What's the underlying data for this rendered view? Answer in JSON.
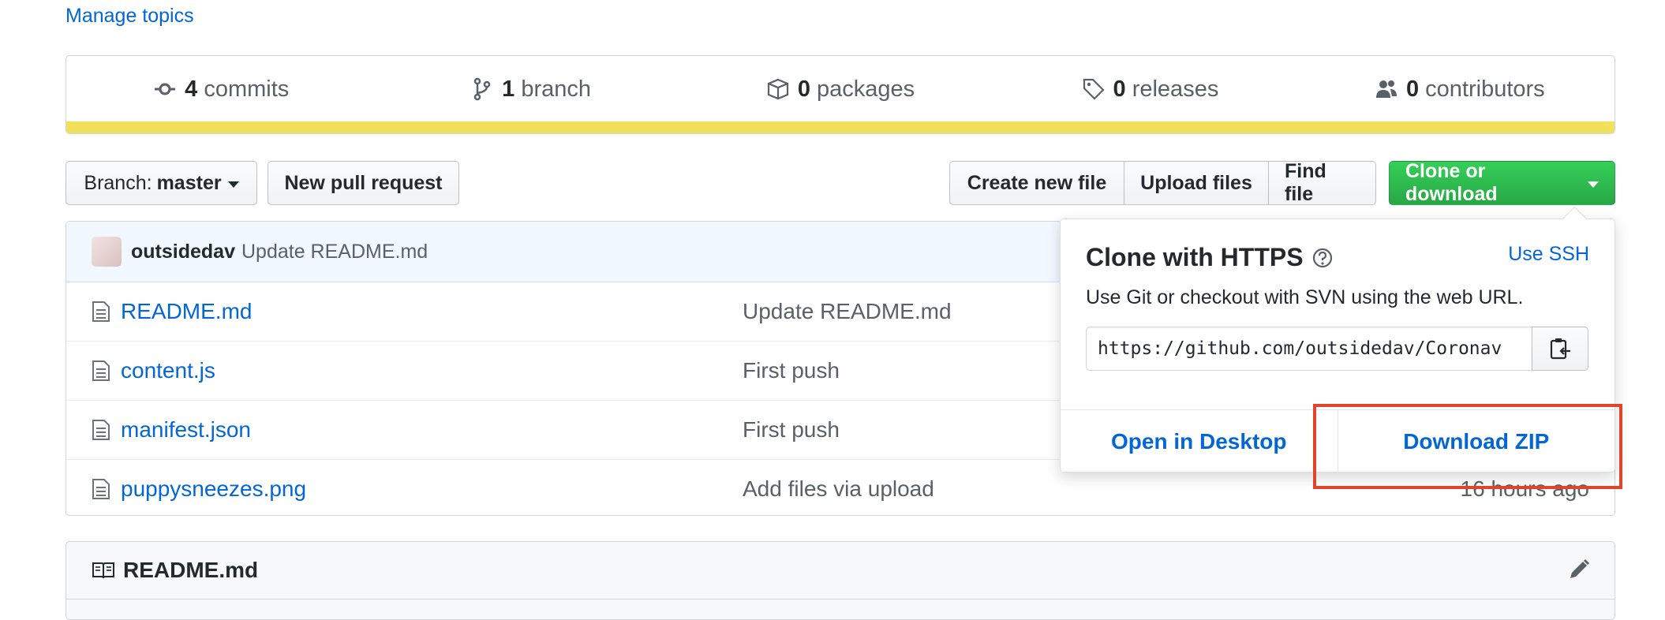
{
  "topics_link": "Manage topics",
  "summary": {
    "commits": {
      "num": "4",
      "label": "commits"
    },
    "branches": {
      "num": "1",
      "label": "branch"
    },
    "packages": {
      "num": "0",
      "label": "packages"
    },
    "releases": {
      "num": "0",
      "label": "releases"
    },
    "contributors": {
      "num": "0",
      "label": "contributors"
    },
    "language_color": "#f1e05a"
  },
  "toolbar": {
    "branch_prefix": "Branch:",
    "branch_name": "master",
    "new_pr": "New pull request",
    "create_file": "Create new file",
    "upload_files": "Upload files",
    "find_file": "Find file",
    "clone_download": "Clone or download"
  },
  "latest_commit": {
    "author": "outsidedav",
    "message": "Update README.md"
  },
  "files": [
    {
      "name": "README.md",
      "message": "Update README.md",
      "age": ""
    },
    {
      "name": "content.js",
      "message": "First push",
      "age": ""
    },
    {
      "name": "manifest.json",
      "message": "First push",
      "age": ""
    },
    {
      "name": "puppysneezes.png",
      "message": "Add files via upload",
      "age": "16 hours ago"
    }
  ],
  "readme_header": "README.md",
  "clone_dropdown": {
    "title": "Clone with HTTPS",
    "use_ssh": "Use SSH",
    "description": "Use Git or checkout with SVN using the web URL.",
    "url": "https://github.com/outsidedav/Coronav",
    "open_desktop": "Open in Desktop",
    "download_zip": "Download ZIP"
  },
  "colors": {
    "link": "#0366d6",
    "primary_button": "#28a745",
    "highlight": "#e0442a"
  }
}
